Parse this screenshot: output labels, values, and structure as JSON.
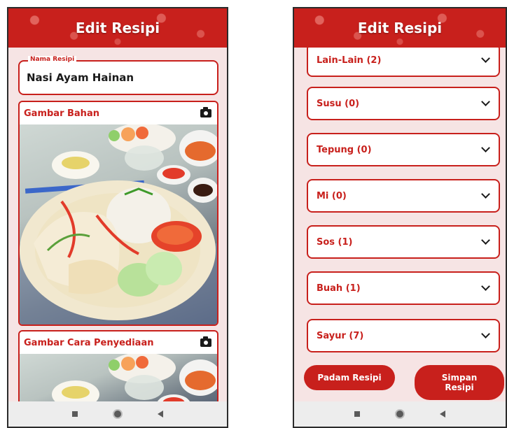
{
  "left_screen": {
    "header": {
      "title": "Edit Resipi"
    },
    "recipe_name": {
      "label": "Nama Resipi",
      "value": "Nasi Ayam Hainan"
    },
    "ingredient_image": {
      "title": "Gambar Bahan",
      "icon": "camera-icon"
    },
    "preparation_image": {
      "title": "Gambar Cara Penyediaan",
      "icon": "camera-icon"
    }
  },
  "right_screen": {
    "header": {
      "title": "Edit Resipi"
    },
    "categories": [
      {
        "label": "Lain-Lain (2)"
      },
      {
        "label": "Susu (0)"
      },
      {
        "label": "Tepung (0)"
      },
      {
        "label": "Mi (0)"
      },
      {
        "label": "Sos (1)"
      },
      {
        "label": "Buah (1)"
      },
      {
        "label": "Sayur (7)"
      }
    ],
    "delete_button": "Padam Resipi",
    "save_button": "Simpan Resipi"
  },
  "colors": {
    "primary": "#c8201c",
    "background": "#f6e4e4",
    "card": "#ffffff"
  }
}
